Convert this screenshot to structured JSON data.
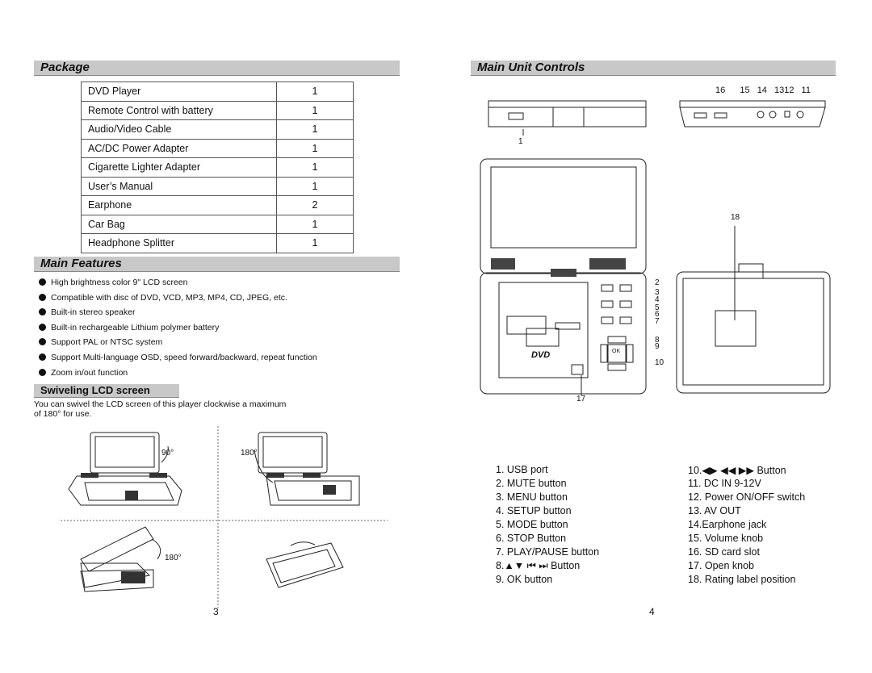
{
  "package": {
    "title": "Package",
    "items": [
      {
        "name": "DVD Player",
        "qty": "1"
      },
      {
        "name": "Remote Control with battery",
        "qty": "1"
      },
      {
        "name": "Audio/Video Cable",
        "qty": "1"
      },
      {
        "name": "AC/DC Power Adapter",
        "qty": "1"
      },
      {
        "name": "Cigarette Lighter Adapter",
        "qty": "1"
      },
      {
        "name": "User’s Manual",
        "qty": "1"
      },
      {
        "name": "Earphone",
        "qty": "2"
      },
      {
        "name": "Car Bag",
        "qty": "1"
      },
      {
        "name": "Headphone Splitter",
        "qty": "1"
      }
    ]
  },
  "features": {
    "title": "Main Features",
    "items": [
      "High brightness color 9\" LCD screen",
      "Compatible with disc of  DVD, VCD, MP3, MP4, CD, JPEG, etc.",
      "Built-in stereo speaker",
      "Built-in rechargeable Lithium polymer battery",
      "Support PAL or NTSC system",
      "Support Multi-language OSD, speed forward/backward, repeat function",
      "Zoom in/out function"
    ]
  },
  "swivel": {
    "title": "Swiveling  LCD screen",
    "text1": "You can swivel the LCD screen of this player clockwise a maximum",
    "text2": "of 180°  for use.",
    "angles": [
      "90°",
      "180°",
      "180°"
    ]
  },
  "controls": {
    "title": "Main Unit Controls",
    "callouts_top": [
      "16",
      "15",
      "14",
      "1312",
      "11"
    ],
    "callouts": {
      "c1": "1",
      "c2": "2",
      "c3": "3",
      "c4": "4",
      "c5": "5",
      "c6": "6",
      "c7": "7",
      "c8": "8",
      "c9": "9",
      "c10": "10",
      "c17": "17",
      "c18": "18"
    },
    "dvd_logo": "DVD",
    "ok": "OK",
    "left": [
      "1. USB port",
      "2. MUTE button",
      "3. MENU button",
      "4. SETUP button",
      "5. MODE button",
      "6. STOP Button",
      "7. PLAY/PAUSE button",
      "8.▲▼ ⏮ ⏭  Button",
      "9. OK button"
    ],
    "right": [
      "10.◀▶  ◀◀  ▶▶  Button",
      "11. DC IN 9-12V",
      "12. Power ON/OFF switch",
      "13. AV OUT",
      "14.Earphone jack",
      "15. Volume knob",
      "16. SD card slot",
      "17. Open knob",
      "18. Rating label position"
    ]
  },
  "page_numbers": [
    "3",
    "4"
  ]
}
